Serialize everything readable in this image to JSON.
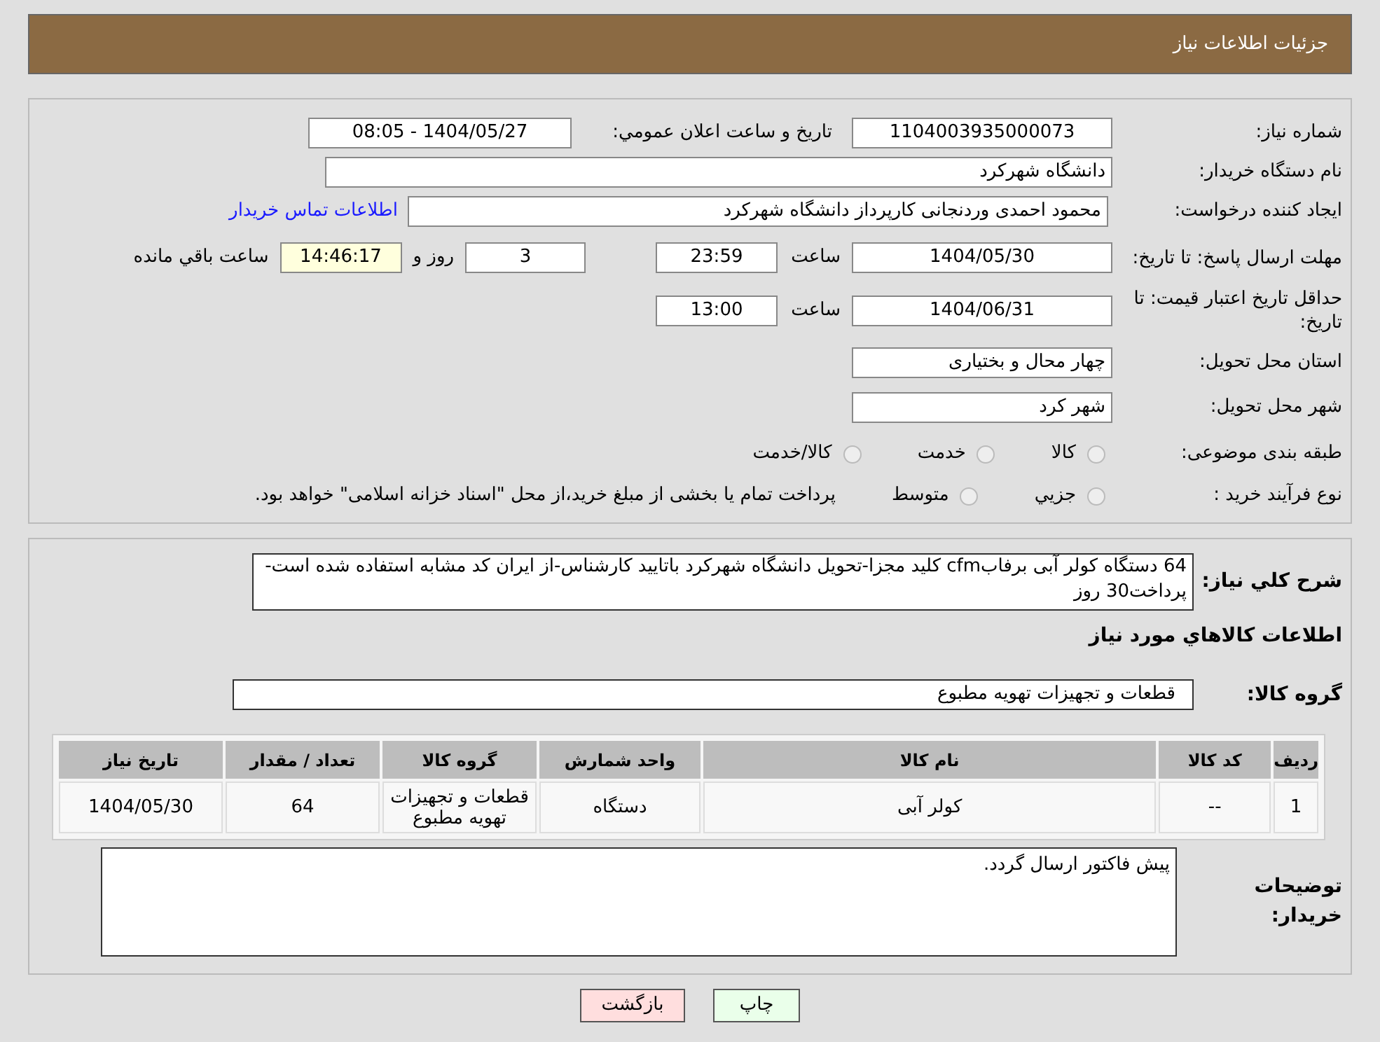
{
  "header": {
    "title": "جزئیات اطلاعات نیاز"
  },
  "need_number": {
    "label": "شماره نیاز:",
    "value": "1104003935000073"
  },
  "announce": {
    "label": "تاریخ و ساعت اعلان عمومي:",
    "value": "1404/05/27 - 08:05"
  },
  "buyer": {
    "label": "نام دستگاه خریدار:",
    "value": "دانشگاه شهرکرد"
  },
  "creator": {
    "label": "ایجاد کننده درخواست:",
    "value": "محمود احمدی وردنجانی کارپرداز دانشگاه شهرکرد",
    "link": "اطلاعات تماس خریدار"
  },
  "deadline": {
    "label": "مهلت ارسال پاسخ: تا تاریخ:",
    "date": "1404/05/30",
    "time_label": "ساعت",
    "time": "23:59",
    "days": "3",
    "days_label": "روز و",
    "remaining": "14:46:17",
    "remaining_label": "ساعت باقي مانده"
  },
  "validity": {
    "label": "حداقل تاریخ اعتبار قیمت: تا تاریخ:",
    "date": "1404/06/31",
    "time_label": "ساعت",
    "time": "13:00"
  },
  "province": {
    "label": "استان محل تحویل:",
    "value": "چهار محال و بختیاری"
  },
  "city": {
    "label": "شهر محل تحویل:",
    "value": "شهر کرد"
  },
  "category": {
    "label": "طبقه بندی موضوعی:",
    "options": [
      {
        "label": "کالا",
        "selected": false
      },
      {
        "label": "خدمت",
        "selected": false
      },
      {
        "label": "کالا/خدمت",
        "selected": false
      }
    ]
  },
  "process": {
    "label": "نوع فرآیند خرید :",
    "options": [
      {
        "label": "جزيي",
        "selected": false
      },
      {
        "label": "متوسط",
        "selected": false
      }
    ],
    "note": "پرداخت تمام یا بخشی از مبلغ خرید،از محل \"اسناد خزانه اسلامی\" خواهد بود."
  },
  "description": {
    "label": "شرح کلي نياز:",
    "value": "64 دستگاه کولر آبی برفابcfm کلید مجزا-تحویل دانشگاه شهرکرد باتایید کارشناس-از ایران کد مشابه استفاده شده است-پرداخت30 روز"
  },
  "goods_title": "اطلاعات کالاهاي مورد نياز",
  "goods_group": {
    "label": "گروه کالا:",
    "value": "قطعات و تجهیزات تهویه مطبوع"
  },
  "table": {
    "columns": [
      "رديف",
      "کد کالا",
      "نام کالا",
      "واحد شمارش",
      "گروه کالا",
      "تعداد / مقدار",
      "تاریخ نیاز"
    ],
    "rows": [
      [
        "1",
        "--",
        "کولر آبی",
        "دستگاه",
        "قطعات و تجهیزات تهویه مطبوع",
        "64",
        "1404/05/30"
      ]
    ]
  },
  "buyer_notes": {
    "label": "توضیحات خریدار:",
    "value": "پیش فاکتور ارسال گردد."
  },
  "buttons": [
    {
      "kind": "print",
      "label": "چاپ"
    },
    {
      "kind": "back",
      "label": "بازگشت"
    }
  ]
}
